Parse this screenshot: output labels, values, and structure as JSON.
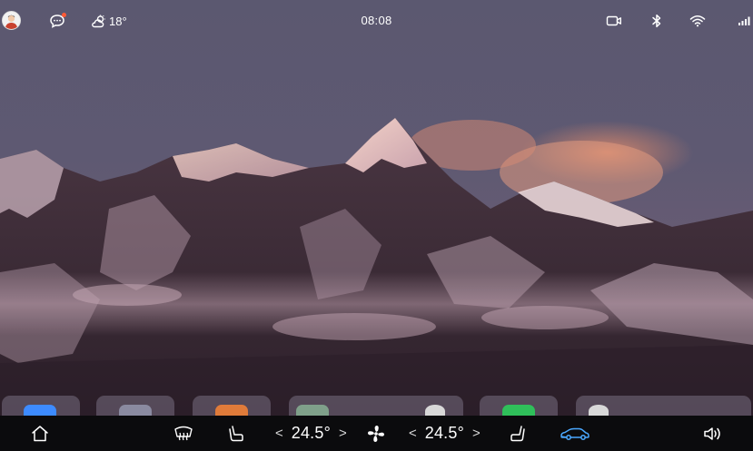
{
  "status_bar": {
    "avatar_icon": "user-avatar-icon",
    "message_icon": "chat-bubble-icon",
    "weather_icon": "partly-cloudy-icon",
    "temperature": "18°",
    "time": "08:08",
    "camera_icon": "dashcam-icon",
    "bluetooth_icon": "bluetooth-icon",
    "wifi_icon": "wifi-icon",
    "signal_icon": "cellular-signal-icon"
  },
  "wallpaper": {
    "description_icon": "mountain-wallpaper"
  },
  "dock": {
    "apps": [
      {
        "name": "app-1",
        "color": "#3d8bff"
      },
      {
        "name": "app-2",
        "color": "#8a8aa0"
      },
      {
        "name": "app-3",
        "color": "#e07b3a"
      },
      {
        "name": "app-4",
        "color": "#7fa08a"
      },
      {
        "name": "app-5",
        "color": "#d8d8d8"
      },
      {
        "name": "app-6",
        "color": "#2fbf5a"
      },
      {
        "name": "app-7",
        "color": "#d8d8d8"
      }
    ]
  },
  "control_bar": {
    "home_icon": "home-icon",
    "defrost_icon": "rear-defrost-icon",
    "driver_seat_icon": "seat-heat-icon",
    "driver_temp": "24.5°",
    "fan_icon": "fan-icon",
    "passenger_temp": "24.5°",
    "passenger_seat_icon": "seat-heat-icon",
    "car_icon": "car-status-icon",
    "volume_icon": "volume-icon",
    "decrease_symbol": "<",
    "increase_symbol": ">",
    "accent_color": "#4aa8ff"
  }
}
